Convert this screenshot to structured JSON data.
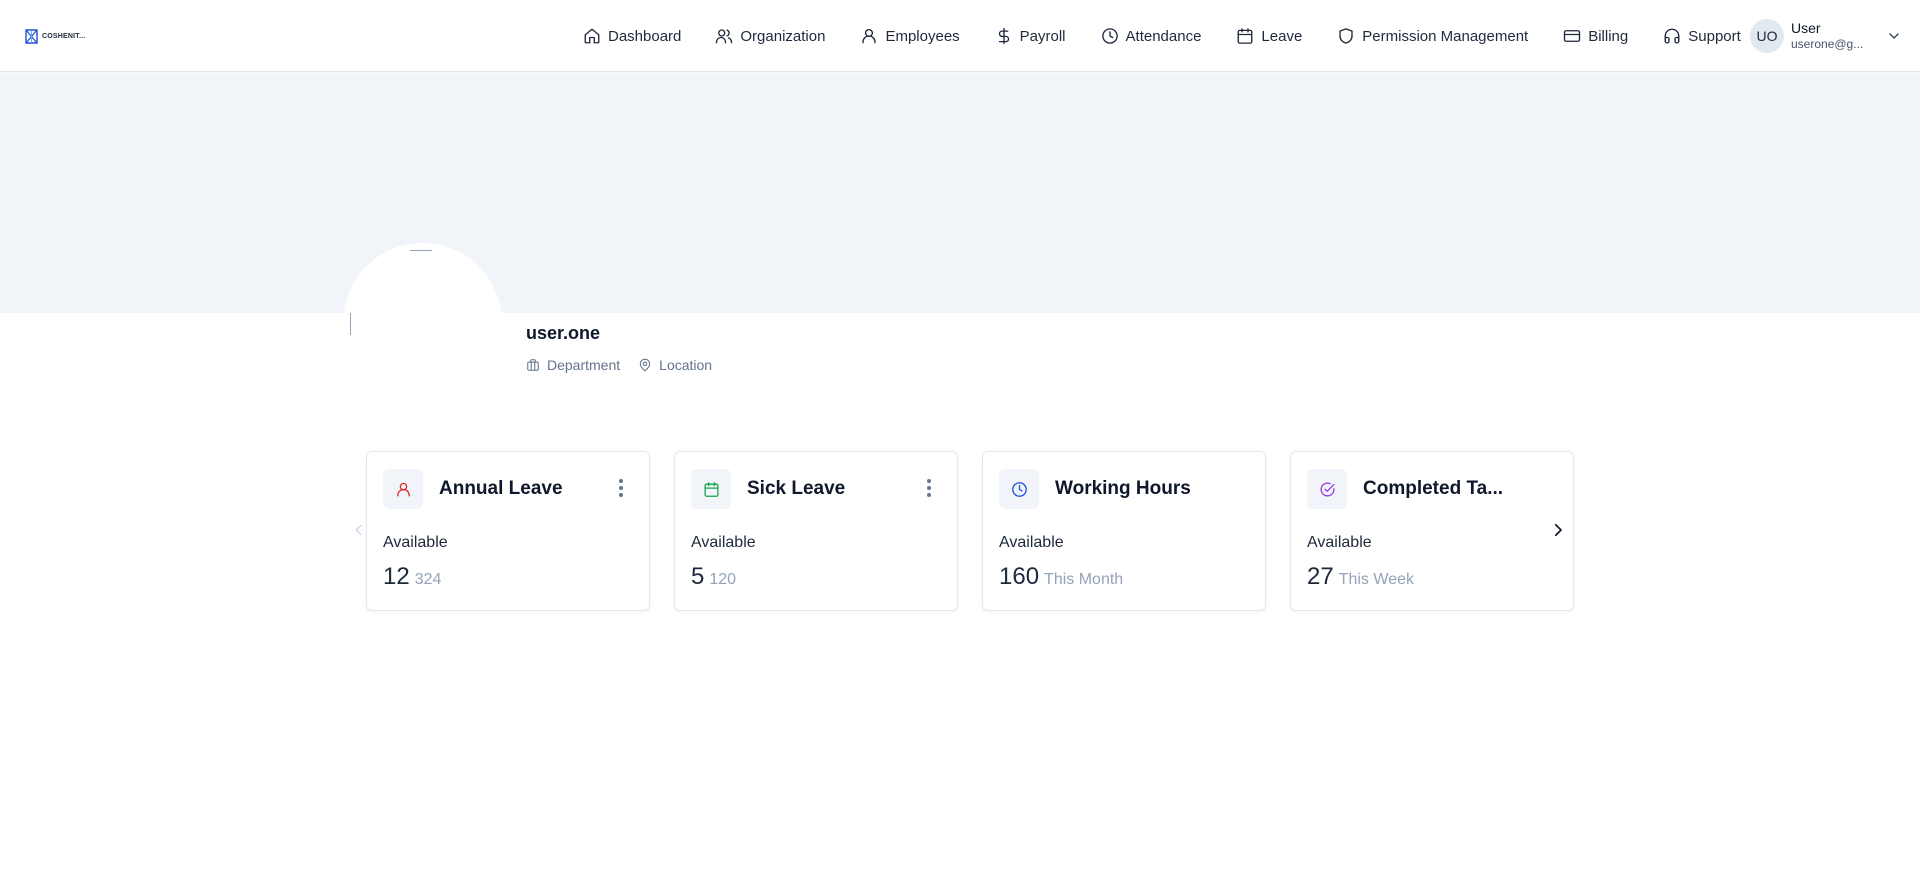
{
  "brand": {
    "logo_text": "COSHENIT...",
    "logo_icon": "cube-logo-icon",
    "accent_color": "#1d4ed8"
  },
  "nav": {
    "items": [
      {
        "label": "Dashboard",
        "icon": "home-icon"
      },
      {
        "label": "Organization",
        "icon": "users-icon"
      },
      {
        "label": "Employees",
        "icon": "user-icon"
      },
      {
        "label": "Payroll",
        "icon": "dollar-icon"
      },
      {
        "label": "Attendance",
        "icon": "clock-icon"
      },
      {
        "label": "Leave",
        "icon": "calendar-icon"
      },
      {
        "label": "Permission Management",
        "icon": "shield-icon"
      },
      {
        "label": "Billing",
        "icon": "credit-card-icon"
      },
      {
        "label": "Support",
        "icon": "headphones-icon"
      }
    ]
  },
  "user": {
    "initials": "UO",
    "name": "User",
    "email": "userone@g..."
  },
  "profile": {
    "username": "user.one",
    "department": "Department",
    "location": "Location"
  },
  "cards": [
    {
      "title": "Annual Leave",
      "label": "Available",
      "value": "12",
      "sub": "324",
      "icon": "user-icon",
      "icon_color": "#dc2626",
      "has_menu": true
    },
    {
      "title": "Sick Leave",
      "label": "Available",
      "value": "5",
      "sub": "120",
      "icon": "calendar-icon",
      "icon_color": "#16a34a",
      "has_menu": true
    },
    {
      "title": "Working Hours",
      "label": "Available",
      "value": "160",
      "sub": "This Month",
      "icon": "clock-icon",
      "icon_color": "#1d4ed8",
      "has_menu": false
    },
    {
      "title": "Completed Ta...",
      "label": "Available",
      "value": "27",
      "sub": "This Week",
      "icon": "check-circle-icon",
      "icon_color": "#9333ea",
      "has_menu": false
    }
  ],
  "colors": {
    "banner": "#f1f5f9",
    "text": "#0f172a",
    "muted": "#64748b"
  }
}
